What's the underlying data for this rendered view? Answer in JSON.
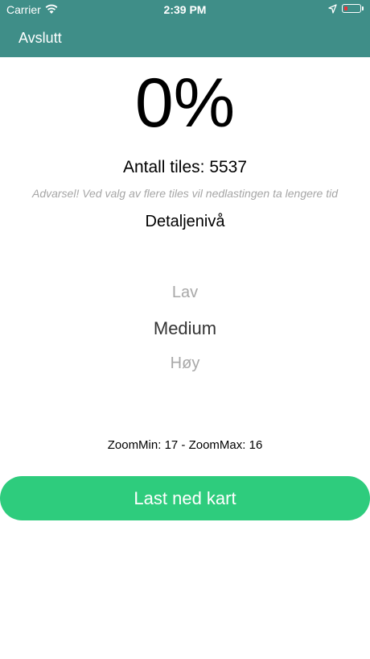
{
  "status_bar": {
    "carrier": "Carrier",
    "time": "2:39 PM",
    "battery_color": "#e5353b"
  },
  "header": {
    "background": "#3f8e88",
    "back_label": "Avslutt"
  },
  "progress": {
    "percent_label": "0%"
  },
  "tiles": {
    "count_label": "Antall tiles: 5537",
    "warning": "Advarsel! Ved valg av flere tiles vil nedlastingen ta lengere tid"
  },
  "detail": {
    "title": "Detaljenivå",
    "options": [
      "Lav",
      "Medium",
      "Høy"
    ],
    "selected": "Medium"
  },
  "zoom_label": "ZoomMin: 17 - ZoomMax: 16",
  "download": {
    "label": "Last ned kart",
    "color": "#2ecc7d"
  }
}
